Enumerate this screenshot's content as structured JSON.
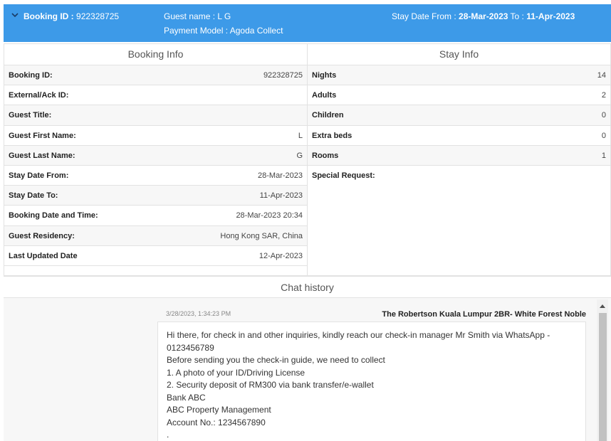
{
  "header": {
    "booking_id_label": "Booking ID :",
    "booking_id_value": "922328725",
    "guest_name": "Guest name : L G",
    "payment_model": "Payment Model : Agoda Collect",
    "stay_from_label": "Stay Date From :",
    "stay_from_value": "28-Mar-2023",
    "stay_to_label": "To :",
    "stay_to_value": "11-Apr-2023"
  },
  "booking_info": {
    "title": "Booking Info",
    "rows": [
      {
        "label": "Booking ID:",
        "value": "922328725"
      },
      {
        "label": "External/Ack ID:",
        "value": ""
      },
      {
        "label": "Guest Title:",
        "value": ""
      },
      {
        "label": "Guest First Name:",
        "value": "L"
      },
      {
        "label": "Guest Last Name:",
        "value": "G"
      },
      {
        "label": "Stay Date From:",
        "value": "28-Mar-2023"
      },
      {
        "label": "Stay Date To:",
        "value": "11-Apr-2023"
      },
      {
        "label": "Booking Date and Time:",
        "value": "28-Mar-2023 20:34"
      },
      {
        "label": "Guest Residency:",
        "value": "Hong Kong SAR, China"
      },
      {
        "label": "Last Updated Date",
        "value": "12-Apr-2023"
      }
    ]
  },
  "stay_info": {
    "title": "Stay Info",
    "rows": [
      {
        "label": "Nights",
        "value": "14"
      },
      {
        "label": "Adults",
        "value": "2"
      },
      {
        "label": "Children",
        "value": "0"
      },
      {
        "label": "Extra beds",
        "value": "0"
      },
      {
        "label": "Rooms",
        "value": "1"
      },
      {
        "label": "Special Request:",
        "value": ""
      }
    ]
  },
  "chat": {
    "title": "Chat history",
    "message": {
      "time": "3/28/2023, 1:34:23 PM",
      "sender": "The Robertson Kuala Lumpur 2BR- White Forest Noble",
      "lines": [
        "Hi there, for check in and other inquiries, kindly reach our check-in manager Mr Smith via WhatsApp -",
        "0123456789",
        "Before sending you the check-in guide, we need to collect",
        "1. A photo of your ID/Driving License",
        "2. Security deposit of RM300 via bank transfer/e-wallet",
        "Bank ABC",
        "ABC Property Management",
        "Account No.: 1234567890",
        "."
      ]
    }
  },
  "colors": {
    "header_bg": "#3d9ae8",
    "row_alt_bg": "#f7f7f7",
    "border": "#e2e2e2"
  },
  "icons": {
    "header_toggle": "chevron-down-icon",
    "scroll_up": "triangle-up-icon"
  }
}
